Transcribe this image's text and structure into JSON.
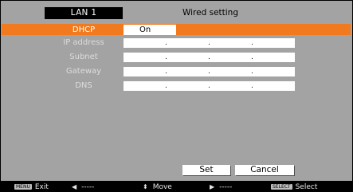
{
  "header": {
    "tab_label": "LAN 1",
    "title": "Wired setting"
  },
  "rows": [
    {
      "label": "DHCP",
      "value": "On"
    },
    {
      "label": "IP address"
    },
    {
      "label": "Subnet"
    },
    {
      "label": "Gateway"
    },
    {
      "label": "DNS"
    }
  ],
  "ip_separator": ".",
  "buttons": {
    "set": "Set",
    "cancel": "Cancel"
  },
  "footer": {
    "menu_key": "MENU",
    "exit_label": "Exit",
    "left_value": "-----",
    "move_label": "Move",
    "right_value": "-----",
    "select_key": "SELECT",
    "select_label": "Select"
  },
  "icons": [
    "menu-key-icon",
    "arrow-left-icon",
    "updown-arrow-icon",
    "arrow-right-icon",
    "select-key-icon"
  ],
  "colors": {
    "panel": "#a3a3a3",
    "selection": "#f07a1d",
    "background": "#000000",
    "field": "#ffffff"
  }
}
